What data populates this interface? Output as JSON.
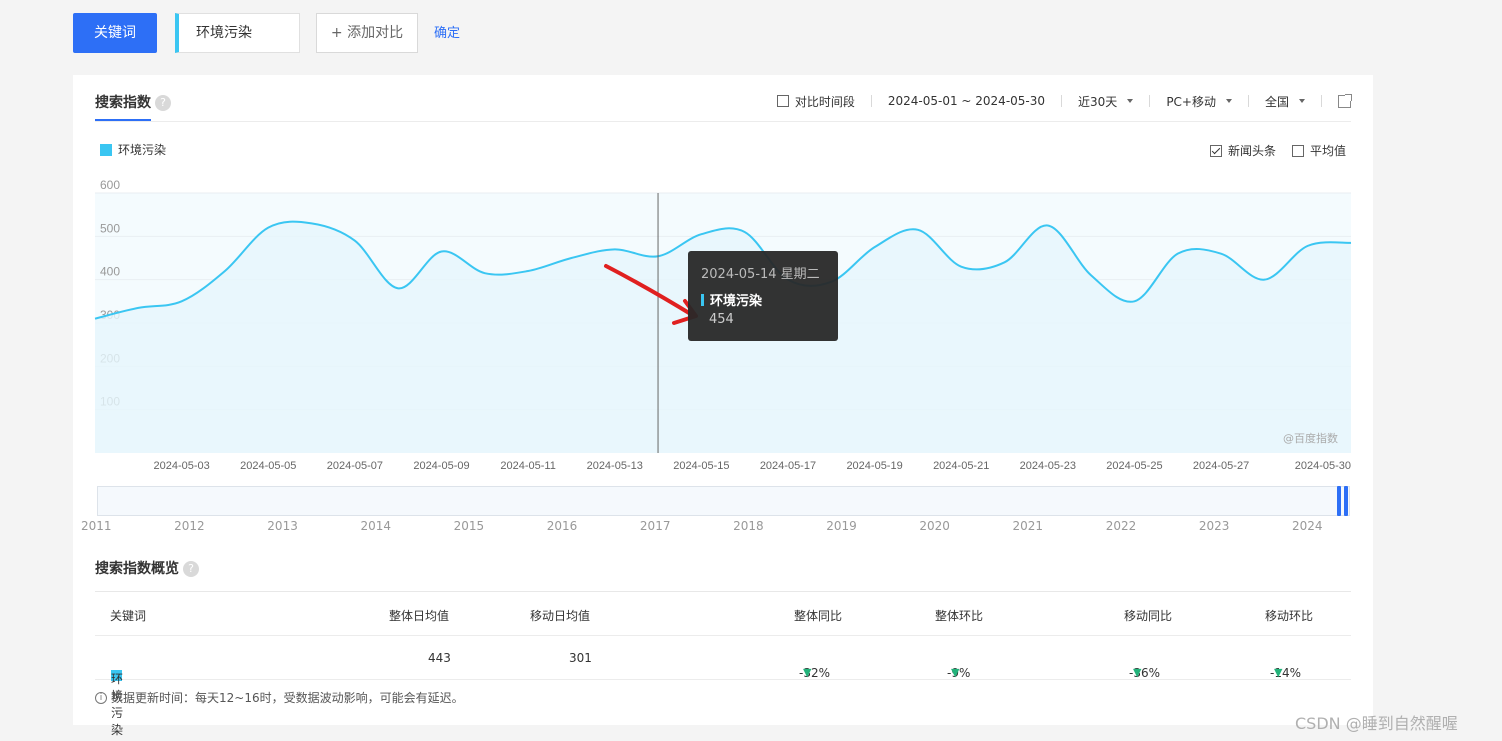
{
  "topbar": {
    "keyword_tab": "关键词",
    "keyword_value": "环境污染",
    "add_compare": "+ 添加对比",
    "confirm": "确定"
  },
  "panel": {
    "title": "搜索指数",
    "filters": {
      "compare_period": "对比时间段",
      "date_range": "2024-05-01 ~ 2024-05-30",
      "period": "近30天",
      "device": "PC+移动",
      "region": "全国"
    },
    "legend": "环境污染",
    "options": {
      "news_headlines": "新闻头条",
      "news_checked": true,
      "average": "平均值",
      "average_checked": false
    },
    "watermark": "@百度指数",
    "tooltip": {
      "date": "2024-05-14 星期二",
      "series": "环境污染",
      "value": "454"
    },
    "range_years": [
      "2011",
      "2012",
      "2013",
      "2014",
      "2015",
      "2016",
      "2017",
      "2018",
      "2019",
      "2020",
      "2021",
      "2022",
      "2023",
      "2024"
    ]
  },
  "chart_data": {
    "type": "area",
    "title": "",
    "xlabel": "",
    "ylabel": "",
    "ylim": [
      0,
      600
    ],
    "yticks": [
      100,
      200,
      300,
      400,
      500,
      600
    ],
    "xtick_labels": [
      "2024-05-03",
      "2024-05-05",
      "2024-05-07",
      "2024-05-09",
      "2024-05-11",
      "2024-05-13",
      "2024-05-15",
      "2024-05-17",
      "2024-05-19",
      "2024-05-21",
      "2024-05-23",
      "2024-05-25",
      "2024-05-27",
      "2024-05-30"
    ],
    "x": [
      "2024-05-01",
      "2024-05-02",
      "2024-05-03",
      "2024-05-04",
      "2024-05-05",
      "2024-05-06",
      "2024-05-07",
      "2024-05-08",
      "2024-05-09",
      "2024-05-10",
      "2024-05-11",
      "2024-05-12",
      "2024-05-13",
      "2024-05-14",
      "2024-05-15",
      "2024-05-16",
      "2024-05-17",
      "2024-05-18",
      "2024-05-19",
      "2024-05-20",
      "2024-05-21",
      "2024-05-22",
      "2024-05-23",
      "2024-05-24",
      "2024-05-25",
      "2024-05-26",
      "2024-05-27",
      "2024-05-28",
      "2024-05-29",
      "2024-05-30"
    ],
    "series": [
      {
        "name": "环境污染",
        "color": "#3ac6f2",
        "values": [
          310,
          335,
          350,
          420,
          520,
          530,
          490,
          380,
          465,
          415,
          420,
          450,
          470,
          454,
          505,
          510,
          400,
          395,
          475,
          515,
          430,
          440,
          525,
          410,
          350,
          460,
          460,
          400,
          478,
          485
        ]
      }
    ],
    "highlight_index": 13,
    "grid": true
  },
  "overview": {
    "title": "搜索指数概览",
    "headers": [
      "关键词",
      "整体日均值",
      "移动日均值",
      "整体同比",
      "整体环比",
      "移动同比",
      "移动环比"
    ],
    "row": {
      "keyword": "环境污染",
      "overall_avg": "443",
      "mobile_avg": "301",
      "overall_yoy": "-32%",
      "overall_mom": "-9%",
      "mobile_yoy": "-36%",
      "mobile_mom": "-14%"
    },
    "note": "数据更新时间：每天12~16时，受数据波动影响，可能会有延迟。"
  },
  "watermark_csdn": "CSDN @睡到自然醒喔",
  "colors": {
    "accent": "#2d6ff6",
    "series": "#3ac6f2",
    "down": "#23b27a"
  }
}
